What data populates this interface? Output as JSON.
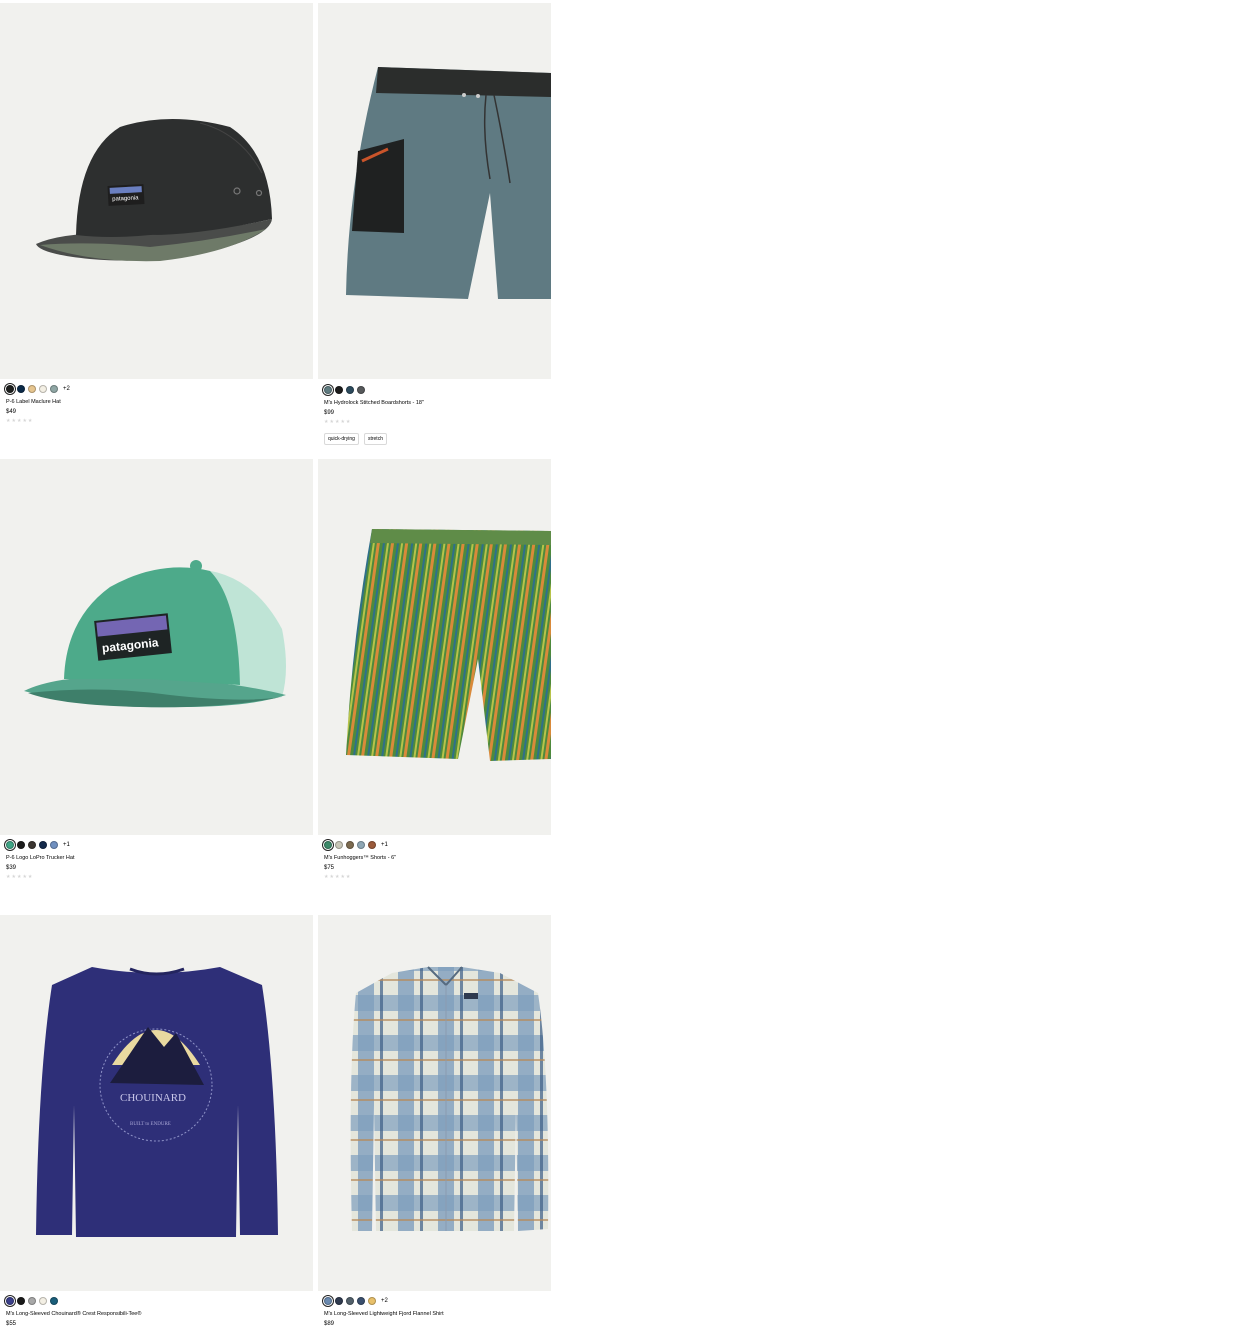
{
  "products": [
    {
      "name": "P-6 Label Maclure Hat",
      "price": "$49",
      "rating_stars": "★★★★★",
      "swatches": [
        "#1d1f1e",
        "#0b2a48",
        "#e6c58f",
        "#f3efe4",
        "#8fa6a4"
      ],
      "more_colors": "+2",
      "tags": []
    },
    {
      "name": "M's Hydrolock Stitched Boardshorts - 18\"",
      "price": "$99",
      "rating_stars": "★★★★★",
      "swatches": [
        "#5f7b80",
        "#1c1c1c",
        "#2c4a5c",
        "#56595b"
      ],
      "more_colors": "",
      "tags": [
        "quick-drying",
        "stretch"
      ]
    },
    {
      "name": "P-6 Logo LoPro Trucker Hat",
      "price": "$39",
      "rating_stars": "★★★★★",
      "swatches": [
        "#3fa586",
        "#1c1c1c",
        "#3b3631",
        "#13294b",
        "#6f8fbf"
      ],
      "more_colors": "+1",
      "tags": []
    },
    {
      "name": "M's Funhoggers™ Shorts - 6\"",
      "price": "$75",
      "rating_stars": "★★★★★",
      "swatches": [
        "#3d8a6a",
        "#c8c6b8",
        "#7c6a4f",
        "#8ea6b4",
        "#9a5a3a"
      ],
      "more_colors": "+1",
      "tags": []
    },
    {
      "name": "M's Long-Sleeved Chouinard® Crest Responsibili-Tee®",
      "price": "$55",
      "rating_stars": "",
      "swatches": [
        "#3a3f8a",
        "#1a1a1a",
        "#a8a8a8",
        "#f3efe4",
        "#1a5e7a"
      ],
      "more_colors": "",
      "tags": []
    },
    {
      "name": "M's Long-Sleeved Lightweight Fjord Flannel Shirt",
      "price": "$89",
      "rating_stars": "",
      "swatches": [
        "#6a8ab0",
        "#2f3a4f",
        "#52606b",
        "#3a4f6e",
        "#e8c06a"
      ],
      "more_colors": "+2",
      "tags": []
    }
  ],
  "illustrations": {
    "hat1_logo": "patagonia",
    "hat2_logo": "patagonia",
    "tee_text": "CHOUINARD",
    "tee_subtext": "BUILT to ENDURE"
  }
}
